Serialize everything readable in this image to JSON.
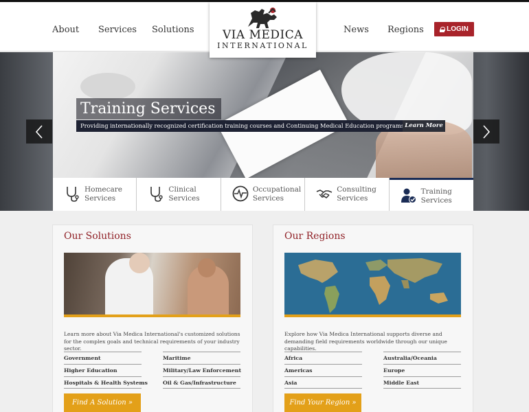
{
  "nav": {
    "left": [
      "About",
      "Services",
      "Solutions"
    ],
    "right": [
      "News",
      "Regions"
    ],
    "login_label": "LOGIN"
  },
  "logo": {
    "line1": "VIA MEDICA",
    "line2": "INTERNATIONAL"
  },
  "hero": {
    "title": "Training Services",
    "subtitle": "Providing internationally recognized certification training courses and Continuing Medical Education programs.",
    "learn_more": "Learn More"
  },
  "tabs": [
    {
      "label": "Homecare Services",
      "icon": "stethoscope-icon"
    },
    {
      "label": "Clinical Services",
      "icon": "stethoscope-icon"
    },
    {
      "label": "Occupational Services",
      "icon": "heartbeat-icon"
    },
    {
      "label": "Consulting Services",
      "icon": "handshake-icon"
    },
    {
      "label": "Training Services",
      "icon": "user-check-icon"
    }
  ],
  "solutions": {
    "title": "Our Solutions",
    "description": "Learn more about Via Medica International's customized solutions for the complex goals and technical requirements of your industry sector.",
    "col1": [
      "Government",
      "Higher Education",
      "Hospitals & Health Systems"
    ],
    "col2": [
      "Maritime",
      "Military/Law Enforcement",
      "Oil & Gas/Infrastructure"
    ],
    "button": "Find A Solution »"
  },
  "regions": {
    "title": "Our Regions",
    "description": "Explore how Via Medica International supports diverse and demanding field requirements worldwide through our unique capabilities.",
    "col1": [
      "Africa",
      "Americas",
      "Asia"
    ],
    "col2": [
      "Australia/Oceania",
      "Europe",
      "Middle East"
    ],
    "button": "Find Your Region »"
  },
  "colors": {
    "brand_red": "#a8232a",
    "accent_gold": "#e3a019",
    "title_red": "#8f1f25",
    "navy": "#1e2233"
  }
}
